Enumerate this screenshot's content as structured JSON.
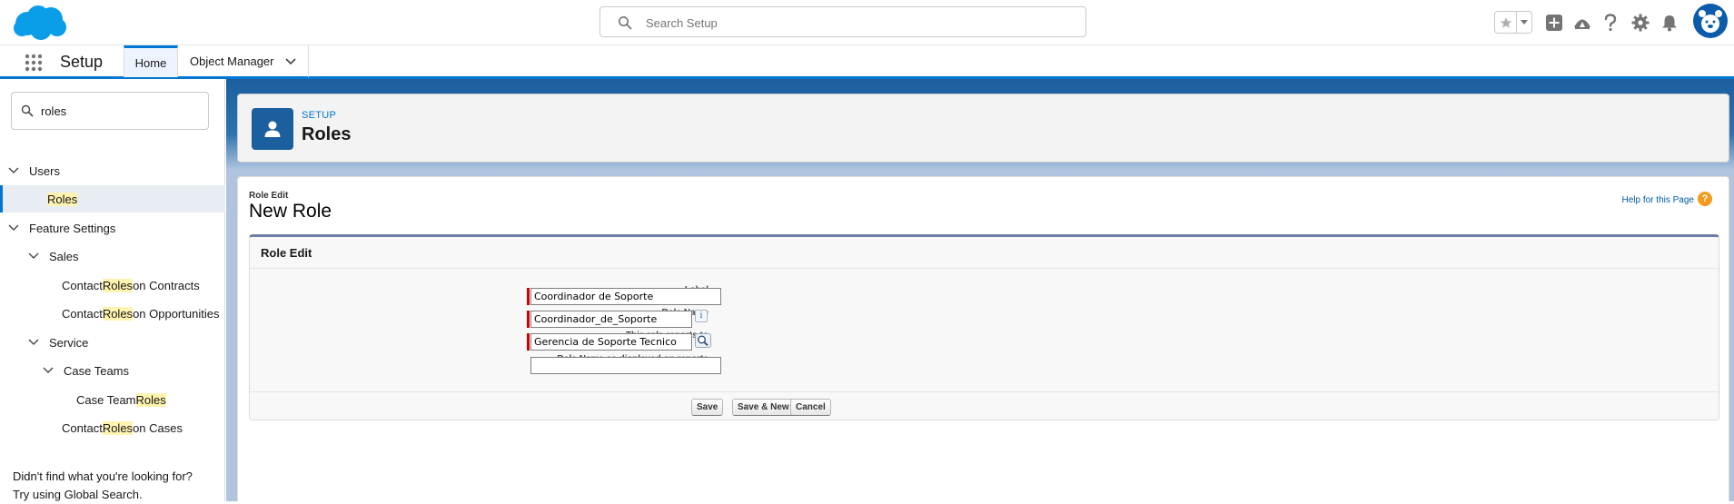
{
  "global_header": {
    "search_placeholder": "Search Setup",
    "icons": [
      "salesforce-logo",
      "favorites-star-icon",
      "favorites-caret-icon",
      "global-actions-icon",
      "trailhead-icon",
      "help-icon",
      "setup-gear-icon",
      "notifications-bell-icon",
      "user-avatar"
    ]
  },
  "app_nav": {
    "app_name": "Setup",
    "tabs": [
      {
        "label": "Home"
      },
      {
        "label": "Object Manager"
      }
    ]
  },
  "sidebar": {
    "quickfind_value": "roles",
    "tree": {
      "users": "Users",
      "roles": "Roles",
      "feature_settings": "Feature Settings",
      "sales": "Sales",
      "contact_roles_contracts": {
        "pre": "Contact ",
        "hl": "Roles",
        "post": " on Contracts"
      },
      "contact_roles_opps": {
        "pre": "Contact ",
        "hl": "Roles",
        "post": " on Opportunities"
      },
      "service": "Service",
      "case_teams": "Case Teams",
      "case_team_roles": {
        "pre": "Case Team ",
        "hl": "Roles"
      },
      "contact_roles_cases": {
        "pre": "Contact ",
        "hl": "Roles",
        "post": " on Cases"
      }
    },
    "not_found_line1": "Didn't find what you're looking for?",
    "not_found_line2": "Try using Global Search."
  },
  "page_header": {
    "eyebrow": "SETUP",
    "title": "Roles"
  },
  "content": {
    "small_title": "Role Edit",
    "title": "New Role",
    "help_link": "Help for this Page",
    "help_icon_glyph": "?"
  },
  "form": {
    "block_title": "Role Edit",
    "fields": [
      {
        "label": "Label",
        "value": "Coordinador de Soporte",
        "required": true
      },
      {
        "label": "Role Name",
        "value": "Coordinador_de_Soporte",
        "required": true
      },
      {
        "label": "This role reports to",
        "value": "Gerencia de Soporte Tecnico",
        "required": true
      },
      {
        "label": "Role Name as displayed on reports",
        "value": "",
        "required": false
      }
    ],
    "info_glyph": "i",
    "buttons": {
      "save": "Save",
      "save_new": "Save & New",
      "cancel": "Cancel"
    }
  },
  "colors": {
    "brand_blue": "#0176d3",
    "required_red": "#cc0000",
    "highlight": "#fff3b0",
    "help_orange": "#f29b1d"
  }
}
